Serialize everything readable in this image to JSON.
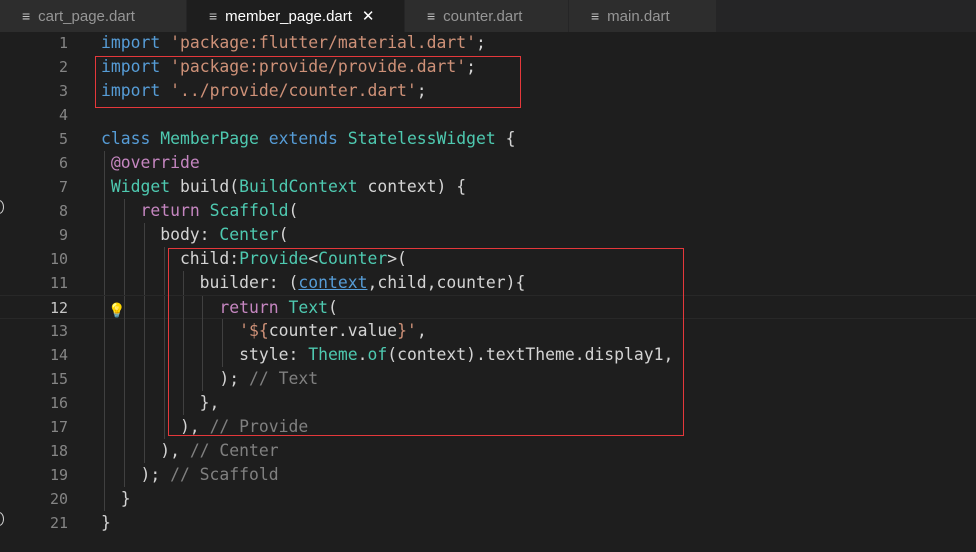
{
  "tabs": [
    {
      "name": "cart_page.dart"
    },
    {
      "name": "member_page.dart",
      "close": "✕"
    },
    {
      "name": "counter.dart"
    },
    {
      "name": "main.dart"
    }
  ],
  "editor": {
    "current_line": 12,
    "lines": [
      {
        "n": "1",
        "tokens": [
          [
            "kw",
            "import"
          ],
          [
            "",
            "",
            " "
          ],
          [
            "str",
            "'package:flutter/material.dart'"
          ],
          [
            "",
            ";"
          ]
        ]
      },
      {
        "n": "2",
        "tokens": [
          [
            "kw",
            "import"
          ],
          [
            "",
            " "
          ],
          [
            "str",
            "'package:provide/provide.dart'"
          ],
          [
            "",
            ";"
          ]
        ]
      },
      {
        "n": "3",
        "tokens": [
          [
            "kw",
            "import"
          ],
          [
            "",
            " "
          ],
          [
            "str",
            "'../provide/counter.dart'"
          ],
          [
            "",
            ";"
          ]
        ]
      },
      {
        "n": "4",
        "tokens": []
      },
      {
        "n": "5",
        "tokens": [
          [
            "kw",
            "class"
          ],
          [
            "",
            " "
          ],
          [
            "cls",
            "MemberPage"
          ],
          [
            "",
            " "
          ],
          [
            "kw",
            "extends"
          ],
          [
            "",
            " "
          ],
          [
            "cls",
            "StatelessWidget"
          ],
          [
            "",
            " {"
          ]
        ]
      },
      {
        "n": "6",
        "tokens": [
          [
            "",
            "",
            " "
          ],
          [
            "ann",
            "@override"
          ]
        ]
      },
      {
        "n": "7",
        "tokens": [
          [
            "",
            " "
          ],
          [
            "cls",
            "Widget"
          ],
          [
            "",
            " build("
          ],
          [
            "cls",
            "BuildContext"
          ],
          [
            "",
            " context) {"
          ]
        ]
      },
      {
        "n": "8",
        "tokens": [
          [
            "",
            "    "
          ],
          [
            "ann",
            "return"
          ],
          [
            "",
            " "
          ],
          [
            "cls",
            "Scaffold"
          ],
          [
            "",
            "("
          ]
        ]
      },
      {
        "n": "9",
        "tokens": [
          [
            "",
            "      body: "
          ],
          [
            "cls",
            "Center"
          ],
          [
            "",
            "("
          ]
        ]
      },
      {
        "n": "10",
        "tokens": [
          [
            "",
            "        child:"
          ],
          [
            "cls",
            "Provide"
          ],
          [
            "",
            "<"
          ],
          [
            "cls",
            "Counter"
          ],
          [
            "",
            ">("
          ]
        ]
      },
      {
        "n": "11",
        "tokens": [
          [
            "",
            "          builder: ("
          ],
          [
            "link",
            "context"
          ],
          [
            "",
            ",child,counter){"
          ]
        ]
      },
      {
        "n": "12",
        "tokens": [
          [
            "",
            "            "
          ],
          [
            "ann",
            "return"
          ],
          [
            "",
            " "
          ],
          [
            "cls",
            "Text"
          ],
          [
            "",
            "("
          ]
        ]
      },
      {
        "n": "13",
        "tokens": [
          [
            "",
            "              "
          ],
          [
            "str",
            "'${"
          ],
          [
            "",
            "counter.value"
          ],
          [
            "str",
            "}'"
          ],
          [
            "",
            ","
          ]
        ]
      },
      {
        "n": "14",
        "tokens": [
          [
            "",
            "              style: "
          ],
          [
            "cls",
            "Theme"
          ],
          [
            "",
            "."
          ],
          [
            "cls",
            "of"
          ],
          [
            "",
            "(context).textTheme.display1,"
          ]
        ]
      },
      {
        "n": "15",
        "tokens": [
          [
            "",
            "            ); "
          ],
          [
            "cmt2",
            "// Text"
          ]
        ]
      },
      {
        "n": "16",
        "tokens": [
          [
            "",
            "          },"
          ]
        ]
      },
      {
        "n": "17",
        "tokens": [
          [
            "",
            "        ), "
          ],
          [
            "cmt2",
            "// Provide"
          ]
        ]
      },
      {
        "n": "18",
        "tokens": [
          [
            "",
            "      ), "
          ],
          [
            "cmt2",
            "// Center"
          ]
        ]
      },
      {
        "n": "19",
        "tokens": [
          [
            "",
            "    ); "
          ],
          [
            "cmt2",
            "// Scaffold"
          ]
        ]
      },
      {
        "n": "20",
        "tokens": [
          [
            "",
            "  }"
          ]
        ]
      },
      {
        "n": "21",
        "tokens": [
          [
            "",
            "}"
          ]
        ]
      }
    ]
  },
  "icons": {
    "file": "file-lines-icon",
    "bulb": "lightbulb-icon",
    "close": "close-icon"
  },
  "colors": {
    "keyword": "#569cd6",
    "string": "#ce9178",
    "type": "#4ec9b0",
    "highlight_box": "#e5383b"
  }
}
